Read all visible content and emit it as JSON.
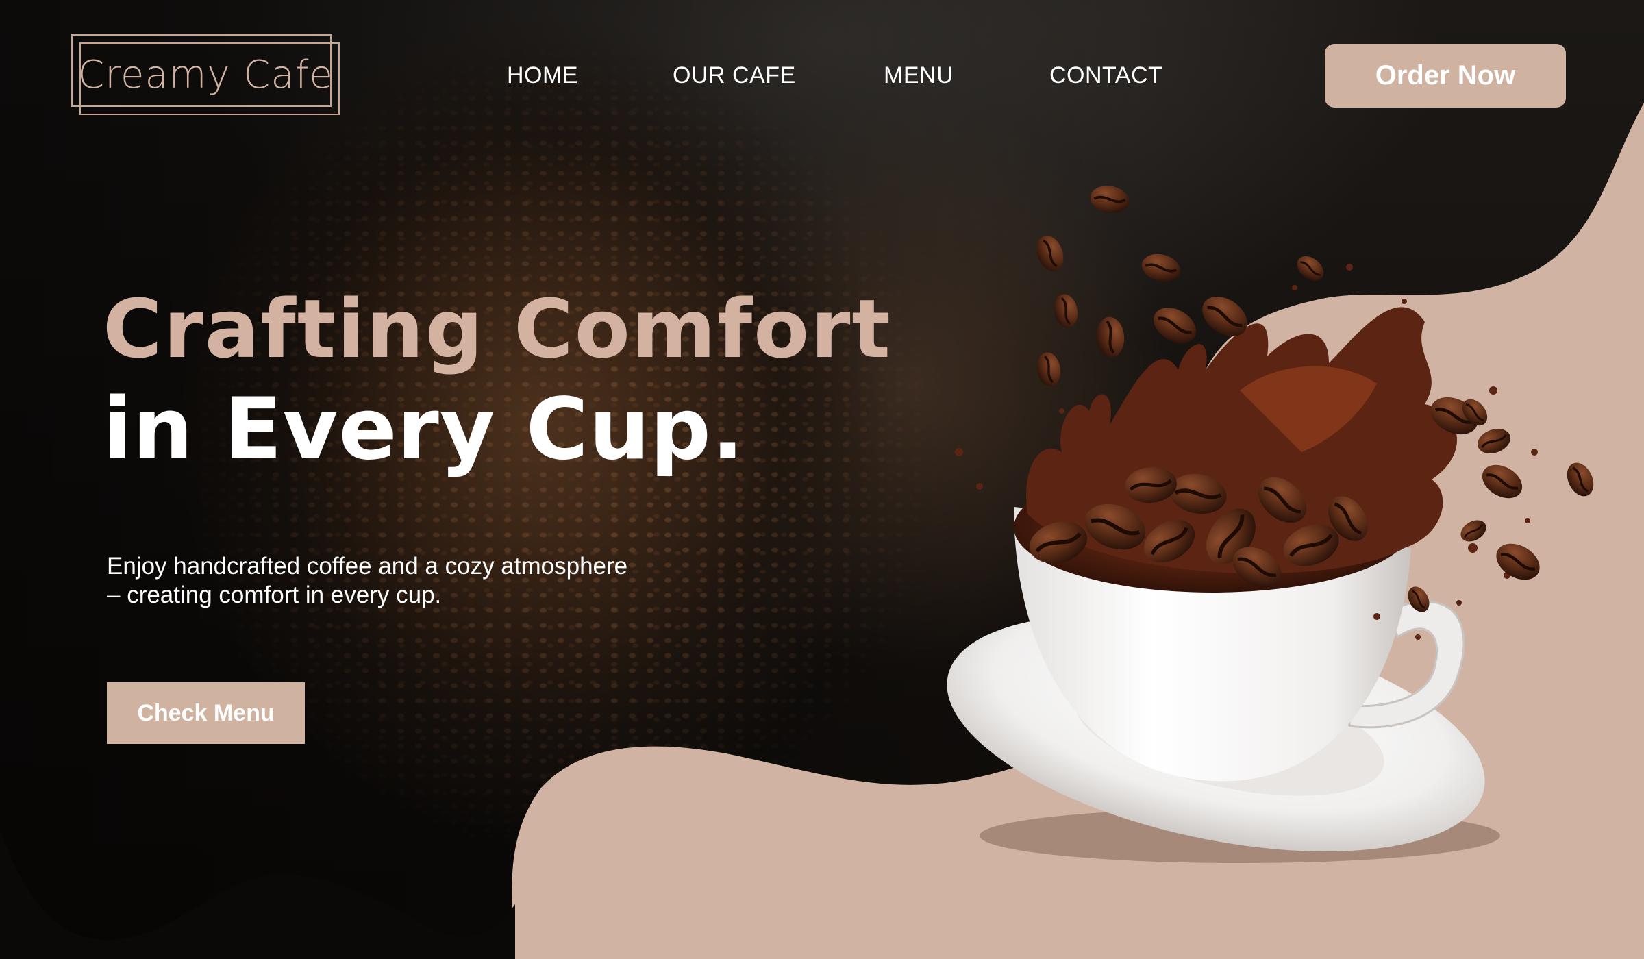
{
  "brand": {
    "logo_text": "Creamy Cafe"
  },
  "nav": {
    "items": [
      {
        "label": "HOME"
      },
      {
        "label": "OUR CAFE"
      },
      {
        "label": "MENU"
      },
      {
        "label": "CONTACT"
      }
    ]
  },
  "header": {
    "order_button": "Order Now"
  },
  "hero": {
    "headline_line_1": "Crafting Comfort",
    "headline_line_2": "in Every Cup.",
    "subtext_line_1": "Enjoy handcrafted coffee and a cozy atmosphere",
    "subtext_line_2": "– creating comfort in every cup.",
    "cta_button": "Check Menu"
  },
  "colors": {
    "accent": "#d0b2a1",
    "accent_text": "#d3b2a1",
    "dark": "#0b0908",
    "coffee": "#5a2512"
  },
  "icons": {
    "illustration": "coffee-cup-splash-with-beans"
  }
}
